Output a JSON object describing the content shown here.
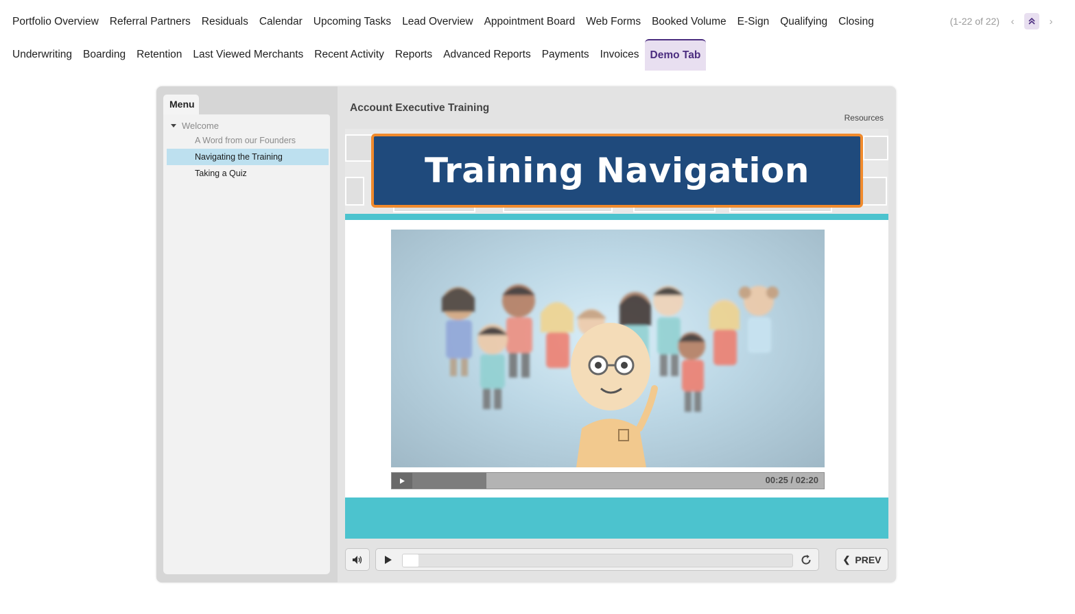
{
  "tabs": {
    "row1": [
      "Portfolio Overview",
      "Referral Partners",
      "Residuals",
      "Calendar",
      "Upcoming Tasks",
      "Lead Overview",
      "Appointment Board",
      "Web Forms",
      "Booked Volume",
      "E-Sign",
      "Qualifying",
      "Closing"
    ],
    "row2": [
      "Underwriting",
      "Boarding",
      "Retention",
      "Last Viewed Merchants",
      "Recent Activity",
      "Reports",
      "Advanced Reports",
      "Payments",
      "Invoices",
      "Demo Tab"
    ],
    "active": "Demo Tab"
  },
  "pager": {
    "text": "(1-22 of 22)",
    "prev_icon": "chevron-left-icon",
    "collapse_icon": "double-chevron-up-icon",
    "next_icon": "chevron-right-icon"
  },
  "player": {
    "menu_label": "Menu",
    "section": "Welcome",
    "items": [
      "A Word from our Founders",
      "Navigating the Training",
      "Taking a Quiz"
    ],
    "active_item": "Navigating the Training",
    "course_title": "Account Executive Training",
    "resources_label": "Resources",
    "slide_title": "Training Navigation",
    "video": {
      "time": "00:25 / 02:20",
      "progress": 0.18
    },
    "seek_progress": 0.04,
    "prev_label": "PREV"
  },
  "colors": {
    "accent": "#4b2d7f",
    "accent_bg": "#e8dff0",
    "banner": "#1f4a7c",
    "banner_border": "#f08a2c",
    "teal": "#4cc3ce",
    "menu_active": "#bde0ef"
  }
}
